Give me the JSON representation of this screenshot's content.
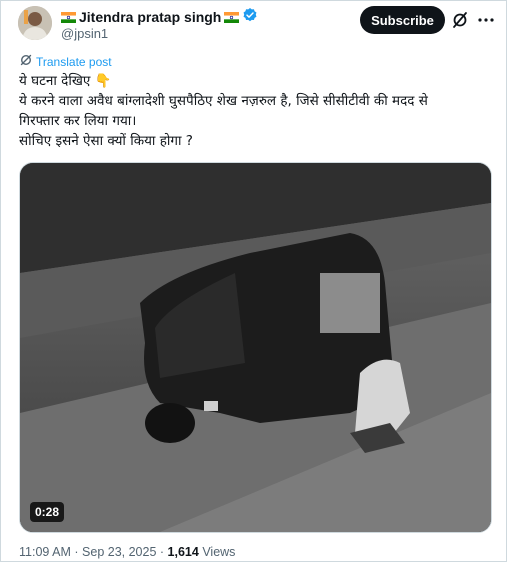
{
  "author": {
    "name": "Jitendra pratap singh",
    "handle": "@jpsin1",
    "flag_icon": "india-flag-icon",
    "verified_icon": "verified-badge-icon"
  },
  "header": {
    "subscribe_label": "Subscribe"
  },
  "translate_label": "Translate post",
  "post_lines": [
    "ये घटना देखिए 👇",
    "ये करने वाला अवैध बांग्लादेशी घुसपैठिए शेख नज़रुल है, जिसे सीसीटीवी की मदद से",
    "गिरफ्तार कर लिया गया।",
    "सोचिए इसने ऐसा क्यों किया होगा ?"
  ],
  "media": {
    "duration": "0:28"
  },
  "meta": {
    "time": "11:09 AM",
    "separator": "·",
    "date": "Sep 23, 2025",
    "views_count": "1,614",
    "views_label": "Views"
  },
  "colors": {
    "accent": "#1d9bf0",
    "text": "#0f1419",
    "muted": "#536471",
    "button_bg": "#0f1419"
  }
}
